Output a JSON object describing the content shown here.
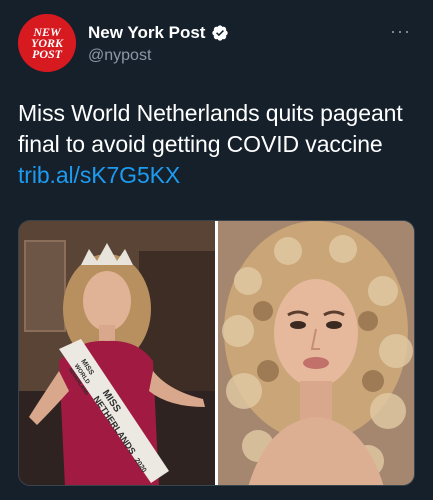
{
  "account": {
    "display_name": "New York Post",
    "handle": "@nypost",
    "avatar_logo_text": [
      "NEW",
      "YORK",
      "POST"
    ],
    "verified": true
  },
  "tweet": {
    "text": "Miss World Netherlands quits pageant final to avoid getting COVID vaccine ",
    "link_text": "trib.al/sK7G5KX"
  },
  "media": {
    "photo_count": 2,
    "sash_text_lines": [
      "MISS",
      "WORLD",
      "NEDERLAND",
      "MISS",
      "NETHERLANDS",
      "2020"
    ]
  },
  "colors": {
    "background": "#15202b",
    "text": "#ffffff",
    "secondary_text": "#8b98a5",
    "link": "#1d9bf0",
    "verified_badge": "#ffffff",
    "avatar": "#d71920"
  },
  "icons": {
    "verified": "verified-badge-icon",
    "more": "more-options-icon"
  }
}
